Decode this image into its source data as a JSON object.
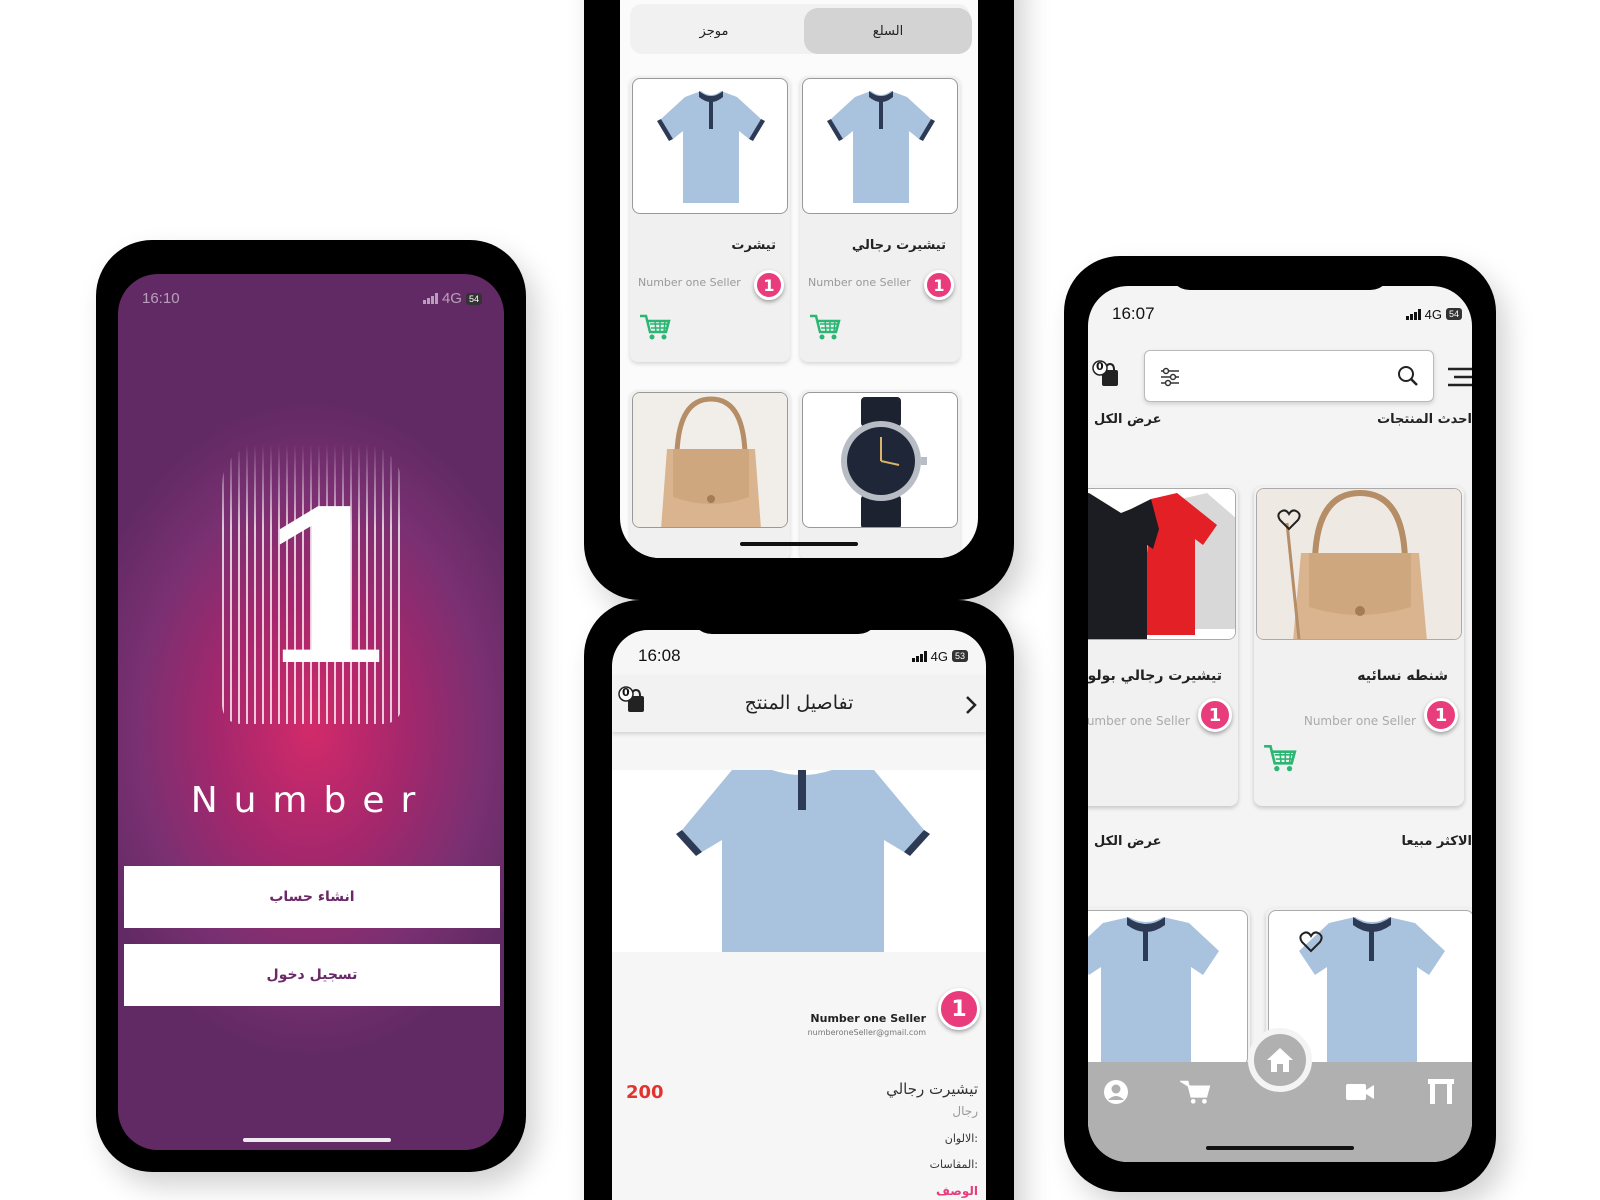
{
  "splash": {
    "time": "16:10",
    "network": "4G",
    "battery": "54",
    "logo_digit": "1",
    "brand": "Number",
    "create_account": "انشاء حساب",
    "login": "تسجيل دخول"
  },
  "grid": {
    "tab_active": "السلع",
    "tab_inactive": "موجز",
    "products": [
      {
        "name": "تيشيرت رجالي",
        "seller": "Number one Seller",
        "badge": "1"
      },
      {
        "name": "تيشرت",
        "seller": "Number one Seller",
        "badge": "1"
      }
    ]
  },
  "details": {
    "time": "16:08",
    "network": "4G",
    "battery": "53",
    "cart_count": "0",
    "title": "تفاصيل المنتج",
    "seller_name": "Number one Seller",
    "seller_email": "numberoneSeller@gmail.com",
    "badge": "1",
    "price": "200",
    "product_name": "تيشيرت رجالي",
    "category": "رجال",
    "colors_label": "الالوان:",
    "sizes_label": "المقاسات:",
    "description_label": "الوصف"
  },
  "home": {
    "time": "16:07",
    "network": "4G",
    "battery": "54",
    "cart_count": "0",
    "latest_title": "احدث المنتجات",
    "view_all_1": "عرض الكل",
    "best_title": "الاكثر مبيعا",
    "view_all_2": "عرض الكل",
    "products": [
      {
        "name": "شنطه نسائيه",
        "seller": "Number one Seller",
        "badge": "1"
      },
      {
        "name": "تيشيرت رجالي بولو",
        "seller": "Number one Seller",
        "badge": "1"
      }
    ]
  },
  "colors": {
    "brand_purple": "#6a2869",
    "accent_pink": "#e83c7c",
    "price_red": "#e2332f",
    "cart_green": "#2bb673"
  }
}
